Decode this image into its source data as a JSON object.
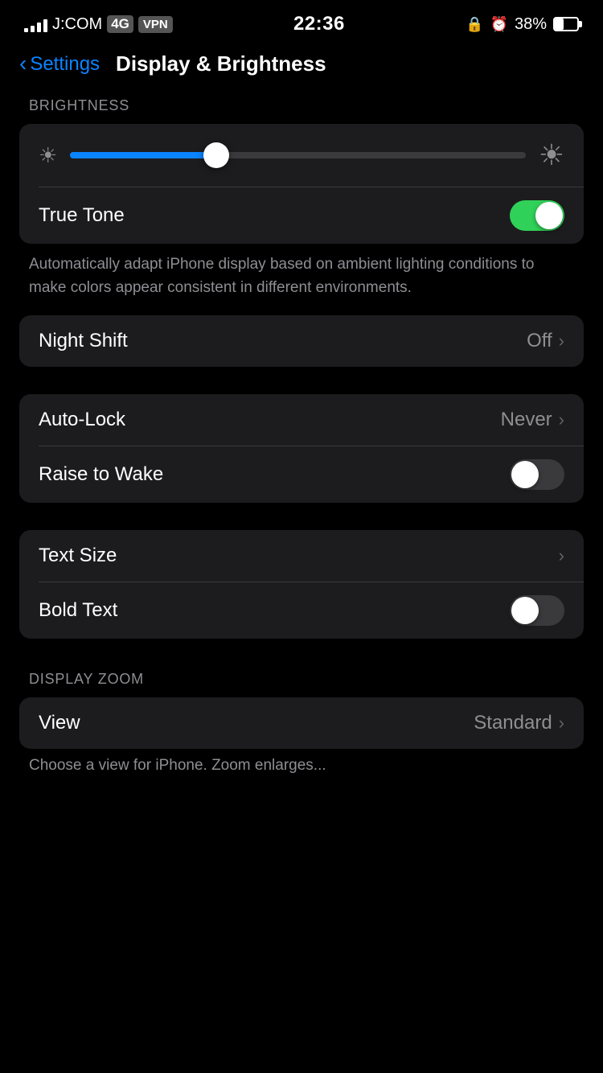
{
  "statusBar": {
    "carrier": "J:COM",
    "network": "4G",
    "vpn": "VPN",
    "time": "22:36",
    "battery_pct": "38%",
    "lock_icon": "🔒",
    "alarm_icon": "⏰"
  },
  "header": {
    "back_label": "Settings",
    "title": "Display & Brightness"
  },
  "sections": {
    "brightness_label": "BRIGHTNESS",
    "display_zoom_label": "DISPLAY ZOOM"
  },
  "brightness": {
    "value": 32
  },
  "trueTone": {
    "label": "True Tone",
    "enabled": true,
    "description": "Automatically adapt iPhone display based on ambient lighting conditions to make colors appear consistent in different environments."
  },
  "nightShift": {
    "label": "Night Shift",
    "value": "Off"
  },
  "autoLock": {
    "label": "Auto-Lock",
    "value": "Never"
  },
  "raiseToWake": {
    "label": "Raise to Wake",
    "enabled": false
  },
  "textSize": {
    "label": "Text Size"
  },
  "boldText": {
    "label": "Bold Text",
    "enabled": false
  },
  "view": {
    "label": "View",
    "value": "Standard"
  },
  "bottomNote": "Choose a view for iPhone. Zoom enlarges..."
}
